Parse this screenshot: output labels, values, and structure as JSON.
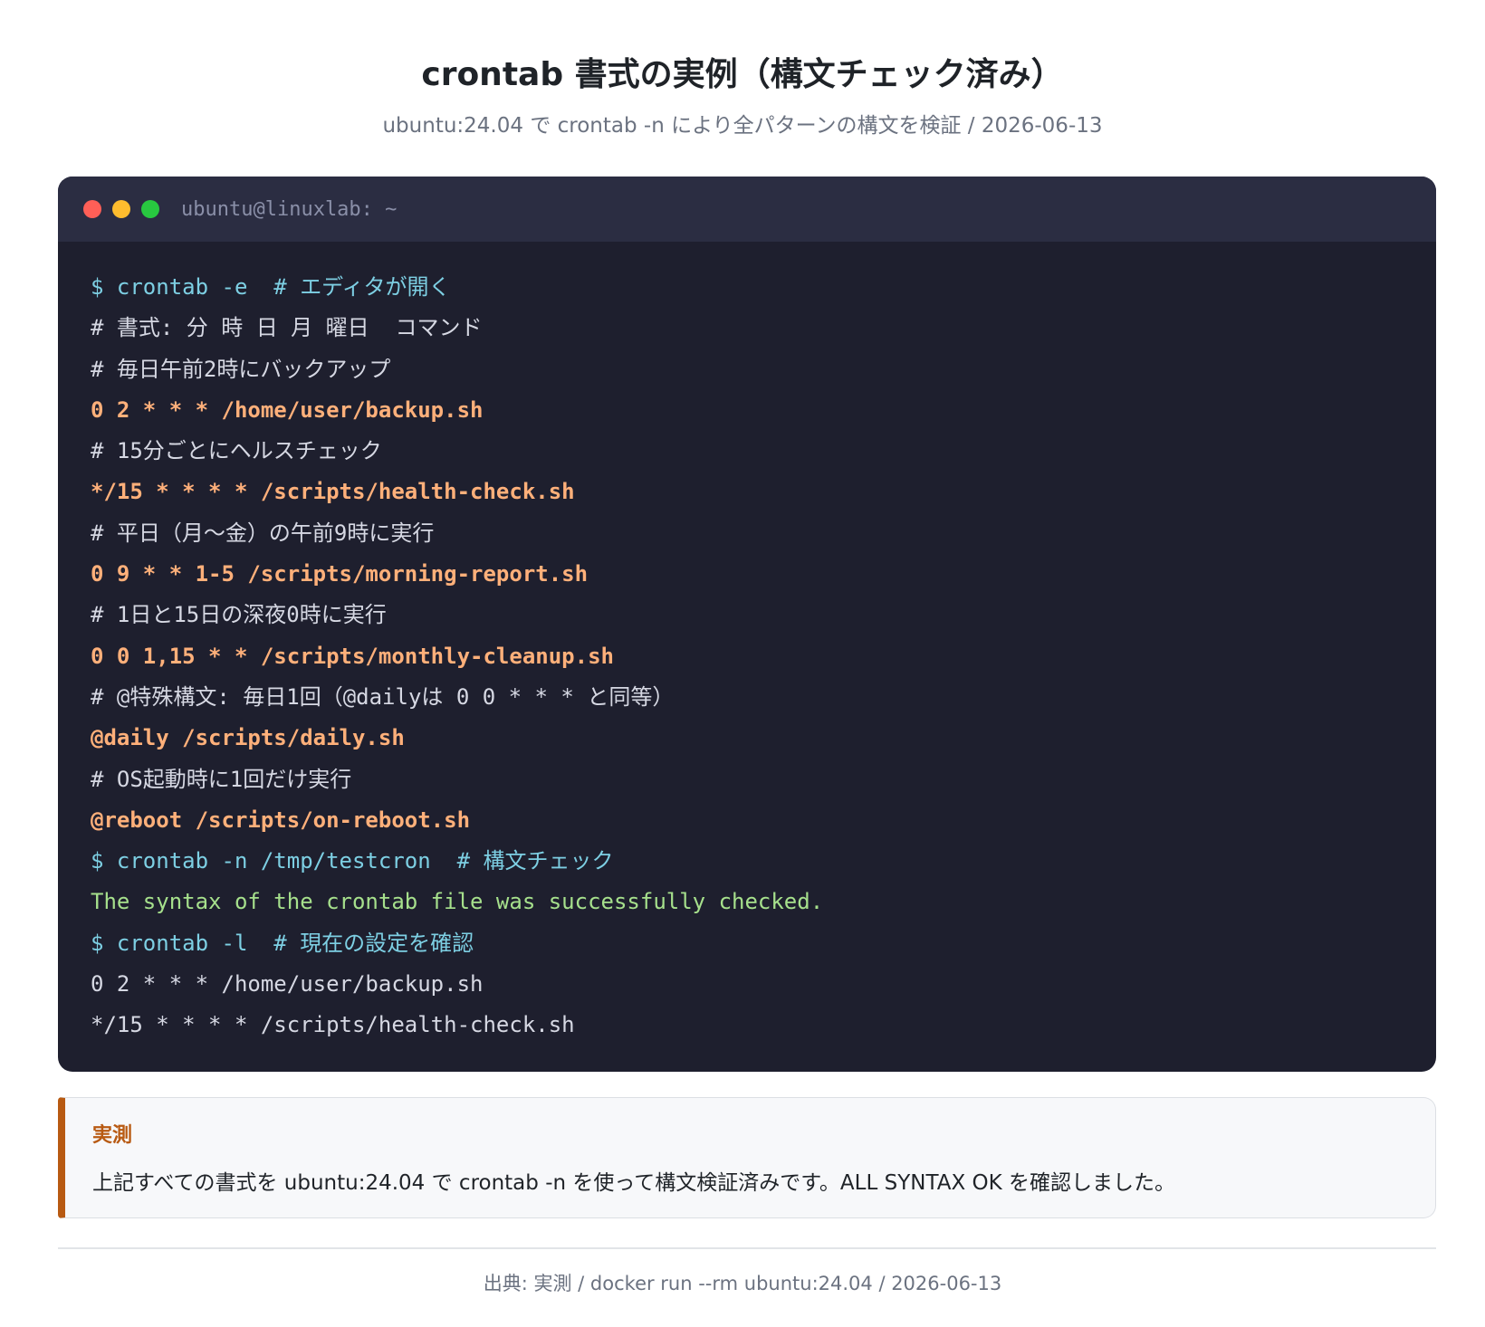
{
  "header": {
    "title": "crontab 書式の実例（構文チェック済み）",
    "subtitle": "ubuntu:24.04 で crontab -n により全パターンの構文を検証 / 2026-06-13"
  },
  "terminal": {
    "window_title": "ubuntu@linuxlab: ~",
    "lines": [
      {
        "type": "cmd",
        "text": "$ crontab -e  # エディタが開く"
      },
      {
        "type": "comment",
        "text": "# 書式: 分 時 日 月 曜日  コマンド"
      },
      {
        "type": "comment",
        "text": "# 毎日午前2時にバックアップ"
      },
      {
        "type": "entry",
        "text": "0 2 * * * /home/user/backup.sh"
      },
      {
        "type": "comment",
        "text": "# 15分ごとにヘルスチェック"
      },
      {
        "type": "entry",
        "text": "*/15 * * * * /scripts/health-check.sh"
      },
      {
        "type": "comment",
        "text": "# 平日（月〜金）の午前9時に実行"
      },
      {
        "type": "entry",
        "text": "0 9 * * 1-5 /scripts/morning-report.sh"
      },
      {
        "type": "comment",
        "text": "# 1日と15日の深夜0時に実行"
      },
      {
        "type": "entry",
        "text": "0 0 1,15 * * /scripts/monthly-cleanup.sh"
      },
      {
        "type": "comment",
        "text": "# @特殊構文: 毎日1回（@dailyは 0 0 * * * と同等）"
      },
      {
        "type": "entry",
        "text": "@daily /scripts/daily.sh"
      },
      {
        "type": "comment",
        "text": "# OS起動時に1回だけ実行"
      },
      {
        "type": "entry",
        "text": "@reboot /scripts/on-reboot.sh"
      },
      {
        "type": "cmd",
        "text": "$ crontab -n /tmp/testcron  # 構文チェック"
      },
      {
        "type": "ok",
        "text": "The syntax of the crontab file was successfully checked."
      },
      {
        "type": "cmd",
        "text": "$ crontab -l  # 現在の設定を確認"
      },
      {
        "type": "out",
        "text": "0 2 * * * /home/user/backup.sh"
      },
      {
        "type": "out",
        "text": "*/15 * * * * /scripts/health-check.sh"
      }
    ]
  },
  "note": {
    "title": "実測",
    "text": "上記すべての書式を ubuntu:24.04 で crontab -n を使って構文検証済みです。ALL SYNTAX OK を確認しました。"
  },
  "footer": {
    "text": "出典: 実測 / docker run --rm ubuntu:24.04 / 2026-06-13"
  },
  "colors": {
    "terminal_bg": "#1e1f2e",
    "terminal_bar": "#2b2d42",
    "command": "#7dcfe3",
    "cron_entry": "#ffb07a",
    "success": "#a6e08c",
    "note_accent": "#b85a12"
  }
}
